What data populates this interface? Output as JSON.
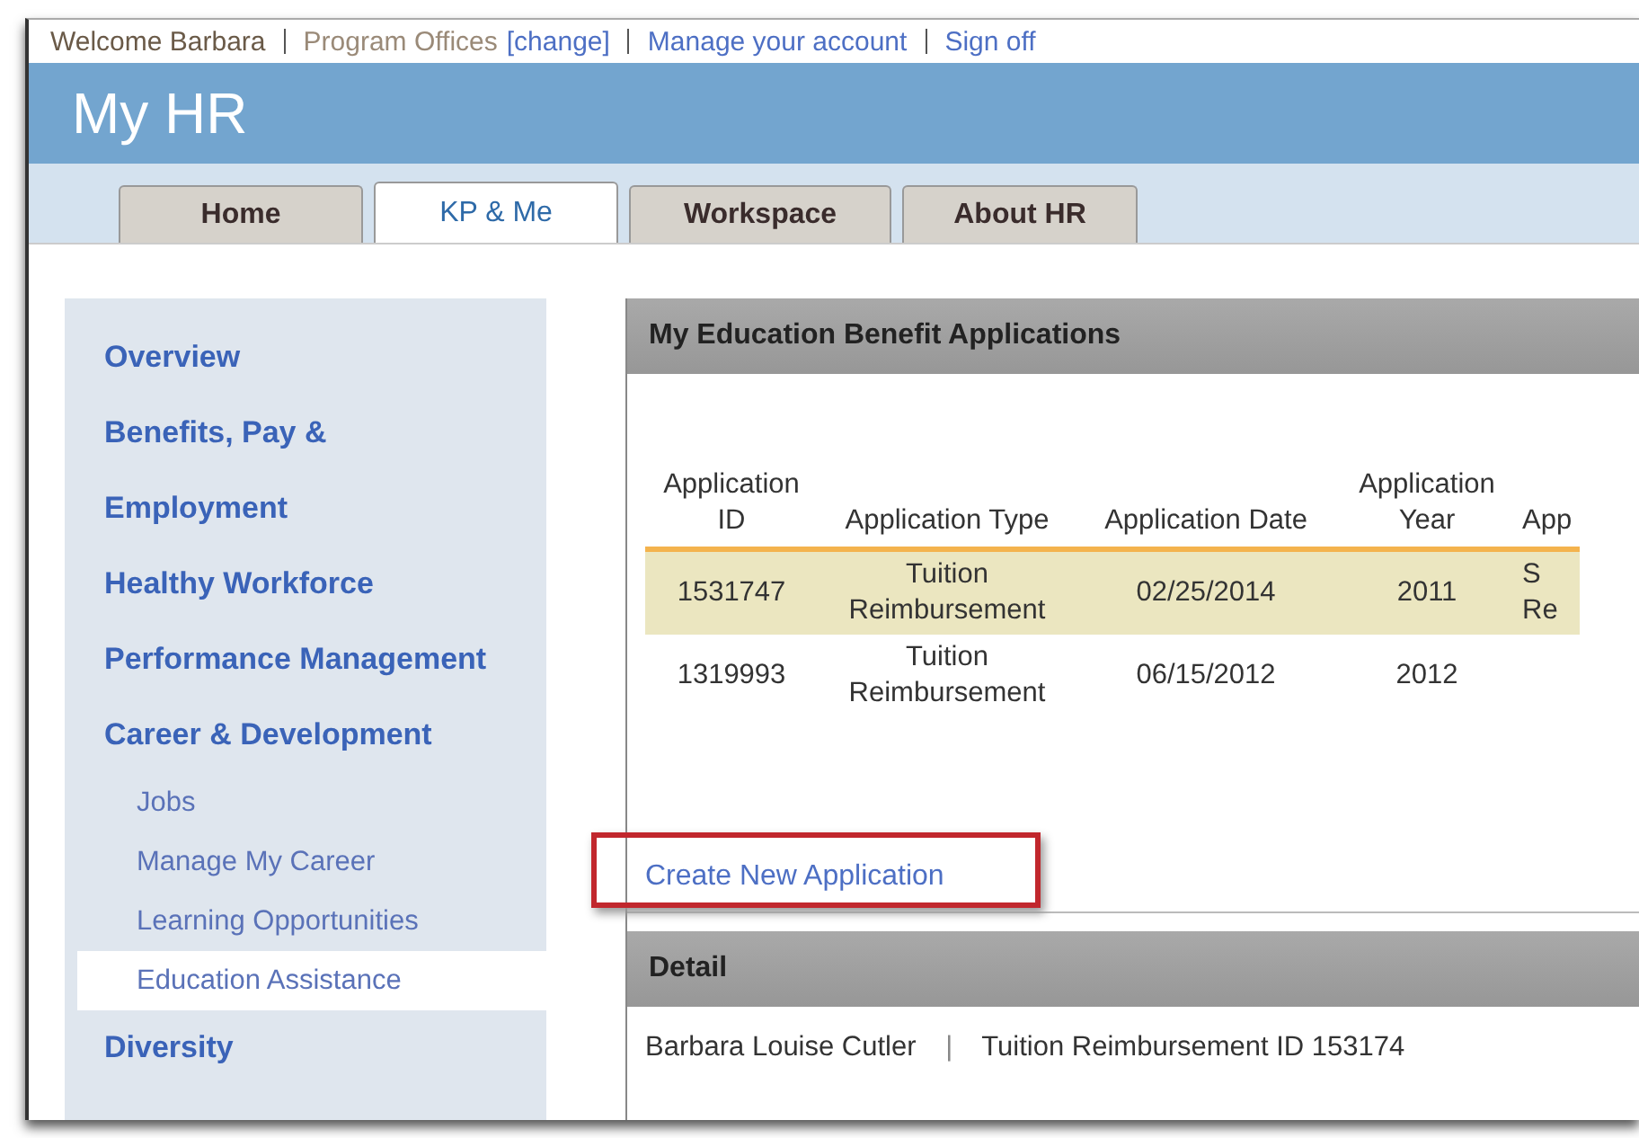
{
  "top_links": [
    {
      "kind": "text",
      "label": "Welcome Barbara"
    },
    {
      "kind": "office",
      "label": "Program Offices"
    },
    {
      "kind": "link",
      "label": "[change]"
    },
    {
      "kind": "link",
      "label": "Manage your account"
    },
    {
      "kind": "link",
      "label": "Sign off"
    }
  ],
  "header": {
    "title": "My HR"
  },
  "tabs": [
    {
      "label": "Home",
      "selected": false
    },
    {
      "label": "KP & Me",
      "selected": true
    },
    {
      "label": "Workspace",
      "selected": false
    },
    {
      "label": "About HR",
      "selected": false
    }
  ],
  "sidebar": {
    "items": [
      {
        "label": "Overview",
        "selected": false
      },
      {
        "label": "Benefits, Pay &",
        "selected": false
      },
      {
        "label": "Employment",
        "selected": false
      },
      {
        "label": "Healthy Workforce",
        "selected": false
      },
      {
        "label": "Performance Management",
        "selected": false
      },
      {
        "label": "Career & Development",
        "selected": false,
        "children": [
          {
            "label": "Jobs",
            "selected": false
          },
          {
            "label": "Manage My Career",
            "selected": false
          },
          {
            "label": "Learning Opportunities",
            "selected": false
          },
          {
            "label": "Education Assistance",
            "selected": true
          }
        ]
      },
      {
        "label": "Diversity",
        "selected": false
      }
    ]
  },
  "applications": {
    "title": "My Education Benefit Applications",
    "table": {
      "columns": [
        "Application ID",
        "Application Type",
        "Application Date",
        "Application Year",
        "App"
      ],
      "rows": [
        {
          "selected": true,
          "cells": [
            "1531747",
            "Tuition Reimbursement",
            "02/25/2014",
            "2011",
            "S Re"
          ]
        },
        {
          "selected": false,
          "cells": [
            "1319993",
            "Tuition Reimbursement",
            "06/15/2012",
            "2012",
            ""
          ]
        }
      ]
    },
    "create_link": "Create New Application"
  },
  "detail": {
    "title": "Detail",
    "name": "Barbara Louise Cutler",
    "separator": "|",
    "record": "Tuition Reimbursement ID 153174"
  }
}
